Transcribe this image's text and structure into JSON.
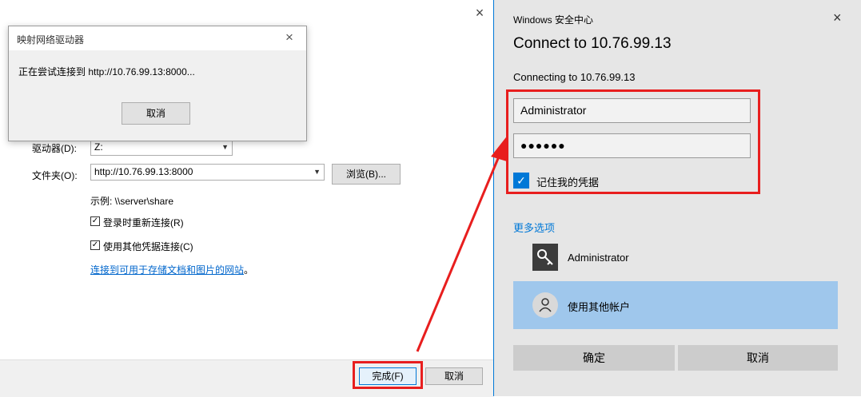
{
  "map_drive": {
    "drive_label": "驱动器(D):",
    "drive_value": "Z:",
    "folder_label": "文件夹(O):",
    "folder_value": "http://10.76.99.13:8000",
    "browse_label": "浏览(B)...",
    "example_text": "示例: \\\\server\\share",
    "reconnect_label": "登录时重新连接(R)",
    "other_credentials_label": "使用其他凭据连接(C)",
    "website_link": "连接到可用于存储文档和图片的网站",
    "website_link_suffix": "。",
    "finish_label": "完成(F)",
    "cancel_label": "取消",
    "close_glyph": "×"
  },
  "connecting": {
    "title": "映射网络驱动器",
    "message": "正在尝试连接到 http://10.76.99.13:8000...",
    "cancel_label": "取消",
    "close_glyph": "×"
  },
  "security": {
    "app_title": "Windows 安全中心",
    "heading": "Connect to 10.76.99.13",
    "subtext": "Connecting to 10.76.99.13",
    "username_value": "Administrator",
    "password_value": "●●●●●●",
    "remember_label": "记住我的凭据",
    "remember_checked": true,
    "more_options": "更多选项",
    "accounts": [
      {
        "label": "Administrator",
        "icon": "key-icon"
      },
      {
        "label": "使用其他帐户",
        "icon": "user-icon"
      }
    ],
    "ok_label": "确定",
    "cancel_label": "取消",
    "close_glyph": "×"
  },
  "colors": {
    "accent": "#0078d7",
    "highlight": "#9fc7ec",
    "annotation": "#e81e1e"
  }
}
